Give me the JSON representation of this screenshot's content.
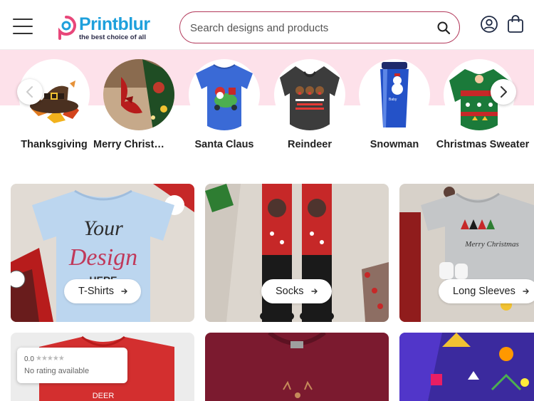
{
  "header": {
    "logo_name": "Printblur",
    "logo_tagline": "the best choice of all",
    "search_placeholder": "Search designs and products"
  },
  "categories": [
    {
      "label": "Thanksgiving"
    },
    {
      "label": "Merry Christmas"
    },
    {
      "label": "Santa Claus"
    },
    {
      "label": "Reindeer"
    },
    {
      "label": "Snowman"
    },
    {
      "label": "Christmas Sweater"
    }
  ],
  "products": [
    {
      "label": "T-Shirts"
    },
    {
      "label": "Socks"
    },
    {
      "label": "Long Sleeves"
    }
  ],
  "rating_badge": {
    "score": "0.0",
    "stars": "★★★★★",
    "text": "No rating available"
  },
  "colors": {
    "brand_blue": "#1ea0dc",
    "brand_pink": "#e8477a",
    "search_border": "#b33a5c",
    "pink_band": "#fde1ea"
  },
  "icons": [
    "menu-icon",
    "search-icon",
    "user-icon",
    "shopping-bag-icon",
    "chevron-left-icon",
    "chevron-right-icon",
    "arrow-right-icon"
  ]
}
